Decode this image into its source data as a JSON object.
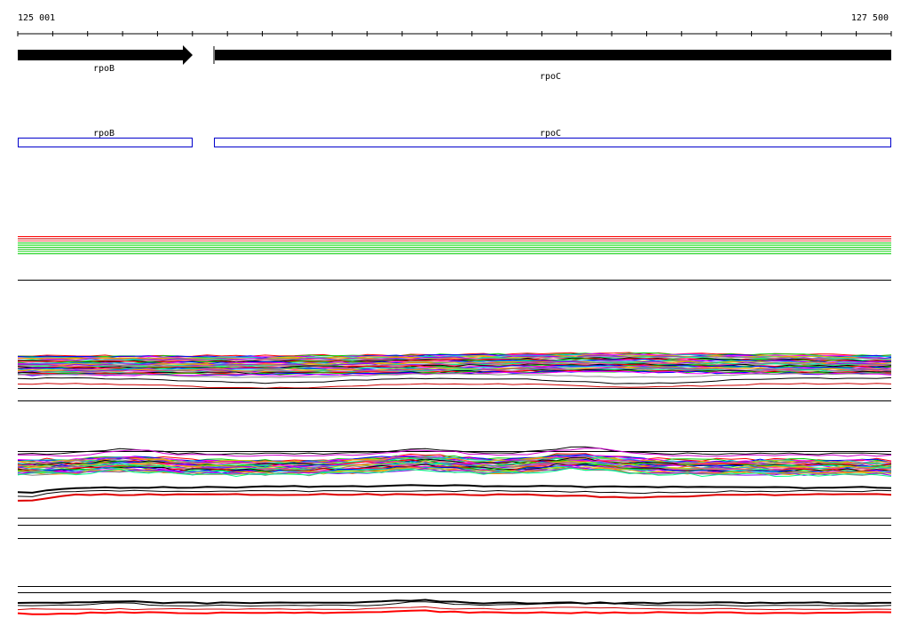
{
  "ruler": {
    "start_label": "125 001",
    "end_label": "127 500"
  },
  "genes": [
    {
      "name": "rpoB"
    },
    {
      "name": "rpoC"
    }
  ],
  "annotations": [
    {
      "name": "rpoB"
    },
    {
      "name": "rpoC"
    }
  ],
  "colors": {
    "arrow": "#000000",
    "annotation_box": "#0000cc",
    "track_line": "#000000"
  },
  "profile_palette": [
    "#ff0000",
    "#00cc00",
    "#0000ff",
    "#ff00ff",
    "#00cccc",
    "#cccc00",
    "#ff8800",
    "#8800ff",
    "#888888",
    "#00ff88",
    "#ff4488",
    "#000000"
  ]
}
